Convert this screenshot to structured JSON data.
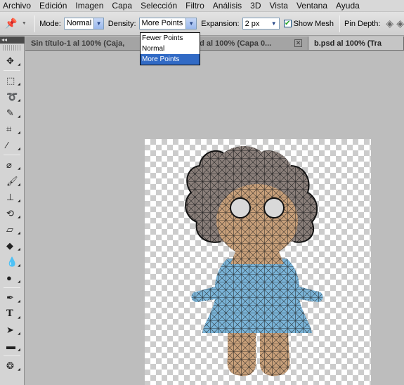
{
  "menubar": {
    "items": [
      "Archivo",
      "Edición",
      "Imagen",
      "Capa",
      "Selección",
      "Filtro",
      "Análisis",
      "3D",
      "Vista",
      "Ventana",
      "Ayuda"
    ]
  },
  "options": {
    "mode_label": "Mode:",
    "mode_value": "Normal",
    "density_label": "Density:",
    "density_value": "More Points",
    "expansion_label": "Expansion:",
    "expansion_value": "2 px",
    "show_mesh_label": "Show Mesh",
    "show_mesh_checked": true,
    "pin_depth_label": "Pin Depth:"
  },
  "density_dropdown": {
    "options": [
      "Fewer Points",
      "Normal",
      "More Points"
    ],
    "selected": "More Points"
  },
  "tabs": [
    {
      "label": "Sin título-1 al 100% (Caja,",
      "active": false
    },
    {
      "label": "rosa.psd al 100% (Capa 0...",
      "active": false
    },
    {
      "label": "b.psd al 100% (Tra",
      "active": true
    }
  ],
  "panel_head": "◂◂",
  "colors": {
    "selection": "#316ac5",
    "mesh_line": "#1a1a1a",
    "skin": "#c8a07a",
    "dress": "#7ab4d8",
    "hair": "#8a8a8a"
  }
}
